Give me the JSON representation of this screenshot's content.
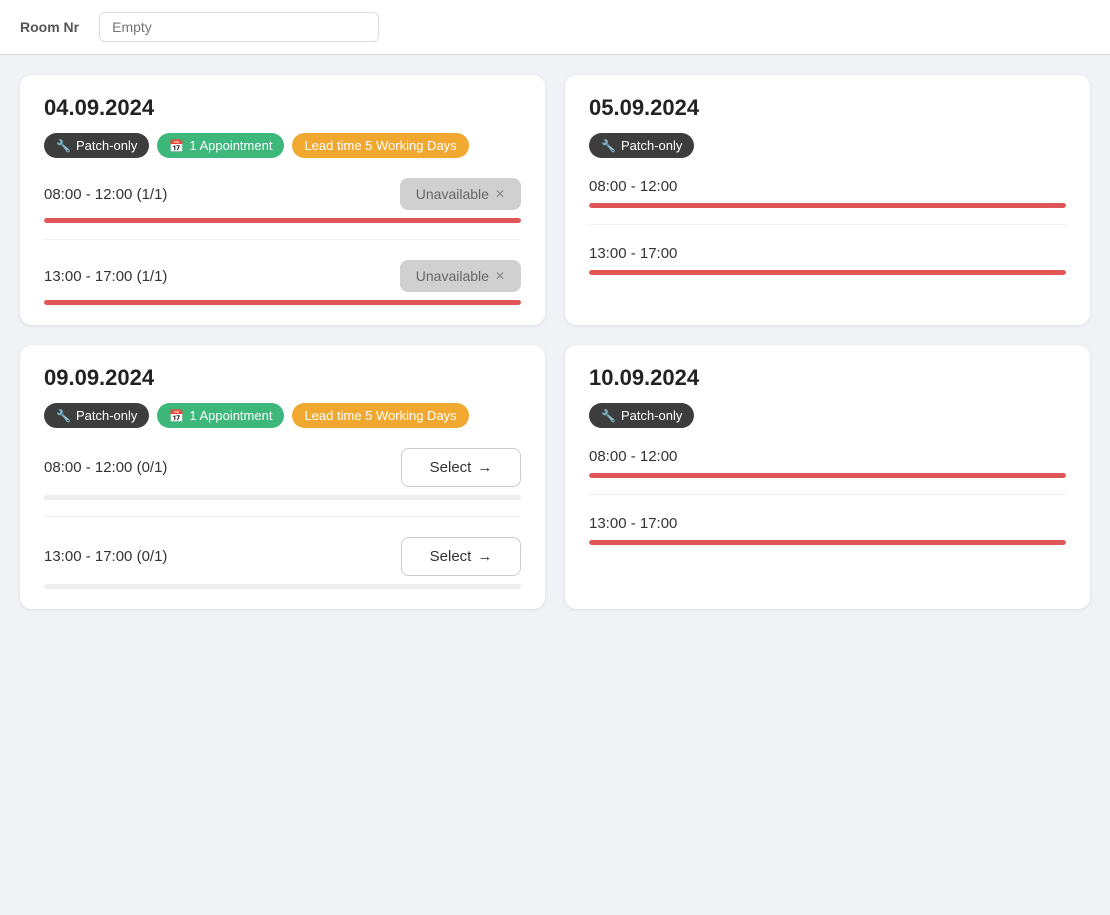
{
  "topbar": {
    "label": "Room Nr",
    "value": "Empty"
  },
  "cards": [
    {
      "id": "card-04-09-2024",
      "date": "04.09.2024",
      "badges": [
        {
          "type": "dark",
          "icon": "wrench",
          "label": "Patch-only"
        },
        {
          "type": "green",
          "icon": "calendar",
          "label": "1 Appointment"
        },
        {
          "type": "yellow",
          "icon": "",
          "label": "Lead time 5 Working Days"
        }
      ],
      "slots": [
        {
          "time": "08:00 - 12:00 (1/1)",
          "status": "unavailable",
          "button_label": "Unavailable",
          "progress": 100,
          "progress_type": "red"
        },
        {
          "time": "13:00 - 17:00 (1/1)",
          "status": "unavailable",
          "button_label": "Unavailable",
          "progress": 100,
          "progress_type": "red"
        }
      ],
      "partial": false
    },
    {
      "id": "card-05-09-2024",
      "date": "05.09.2024",
      "badges": [
        {
          "type": "dark",
          "icon": "wrench",
          "label": "Patch-only"
        }
      ],
      "slots": [
        {
          "time": "08:00 - 12:00",
          "status": "unavailable",
          "button_label": "",
          "progress": 100,
          "progress_type": "red"
        },
        {
          "time": "13:00 - 17:00",
          "status": "unavailable",
          "button_label": "",
          "progress": 100,
          "progress_type": "red"
        }
      ],
      "partial": true
    },
    {
      "id": "card-09-09-2024",
      "date": "09.09.2024",
      "badges": [
        {
          "type": "dark",
          "icon": "wrench",
          "label": "Patch-only"
        },
        {
          "type": "green",
          "icon": "calendar",
          "label": "1 Appointment"
        },
        {
          "type": "yellow",
          "icon": "",
          "label": "Lead time 5 Working Days"
        }
      ],
      "slots": [
        {
          "time": "08:00 - 12:00 (0/1)",
          "status": "select",
          "button_label": "Select →",
          "progress": 0,
          "progress_type": "gray"
        },
        {
          "time": "13:00 - 17:00 (0/1)",
          "status": "select",
          "button_label": "Select →",
          "progress": 0,
          "progress_type": "gray"
        }
      ],
      "partial": false
    },
    {
      "id": "card-10-09-2024",
      "date": "10.09.2024",
      "badges": [
        {
          "type": "dark",
          "icon": "wrench",
          "label": "Patch-only"
        }
      ],
      "slots": [
        {
          "time": "08:00 - 12:00",
          "status": "unavailable",
          "button_label": "",
          "progress": 100,
          "progress_type": "red"
        },
        {
          "time": "13:00 - 17:00",
          "status": "unavailable",
          "button_label": "",
          "progress": 100,
          "progress_type": "red"
        }
      ],
      "partial": true
    }
  ],
  "labels": {
    "unavailable": "Unavailable",
    "select": "Select →",
    "close": "✕",
    "arrow": "→"
  }
}
